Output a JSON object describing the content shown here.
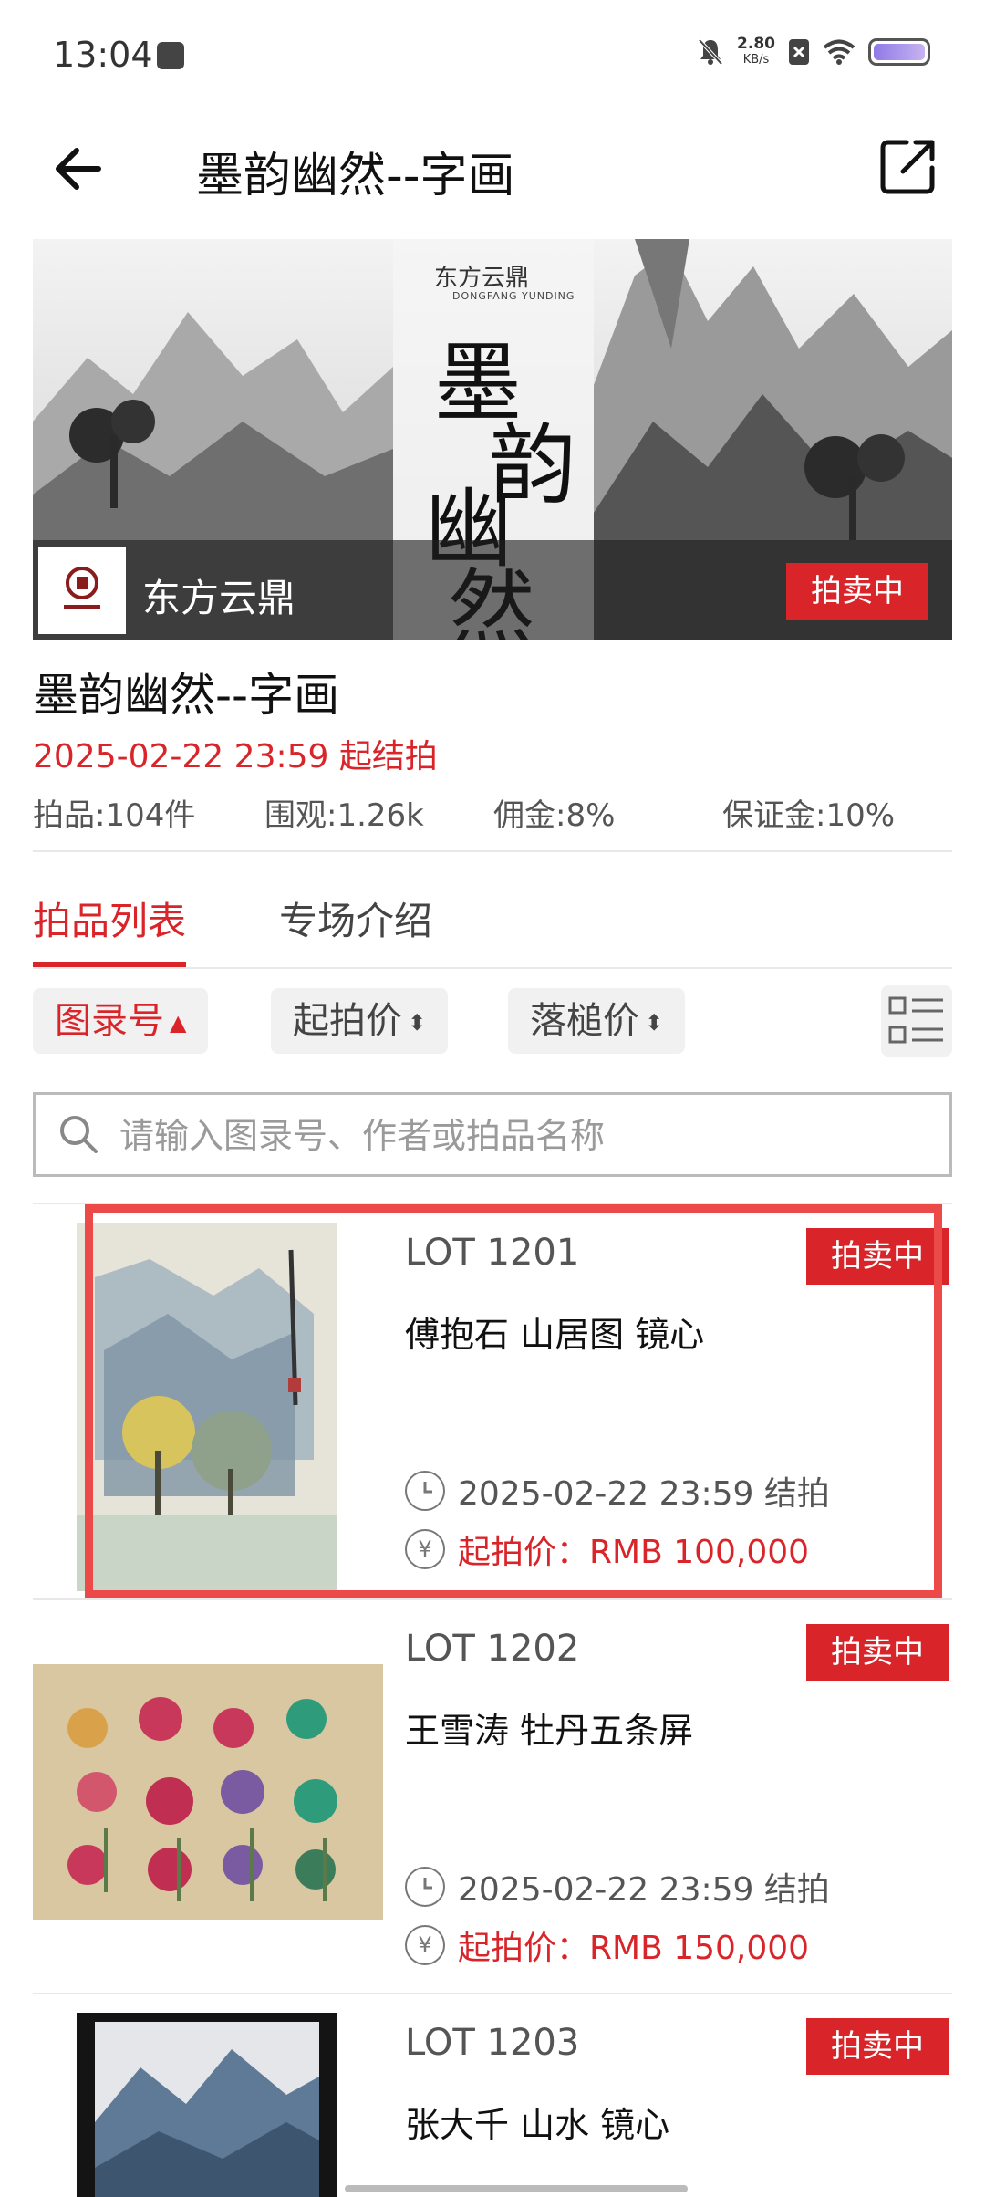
{
  "status_bar": {
    "time": "13:04",
    "speed_value": "2.80",
    "speed_unit": "KB/s"
  },
  "header": {
    "title": "墨韵幽然--字画"
  },
  "banner": {
    "brand_name": "东方云鼎",
    "brand_cn_small": "东方云鼎",
    "brand_en": "DONGFANG YUNDING",
    "calligraphy": [
      "墨",
      "韵",
      "幽",
      "然"
    ],
    "status_badge": "拍卖中"
  },
  "info": {
    "title": "墨韵幽然--字画",
    "date_text": "2025-02-22 23:59 起结拍",
    "stats": {
      "items": "拍品:104件",
      "views": "围观:1.26k",
      "commission": "佣金:8%",
      "deposit": "保证金:10%"
    }
  },
  "tabs": [
    {
      "label": "拍品列表",
      "active": true
    },
    {
      "label": "专场介绍",
      "active": false
    }
  ],
  "sort": [
    {
      "label": "图录号",
      "arrow": "▲",
      "active": true
    },
    {
      "label": "起拍价",
      "arrow": "⬍",
      "active": false
    },
    {
      "label": "落槌价",
      "arrow": "⬍",
      "active": false
    }
  ],
  "search": {
    "placeholder": "请输入图录号、作者或拍品名称"
  },
  "lots": [
    {
      "lot": "LOT 1201",
      "name": "傅抱石 山居图 镜心",
      "badge": "拍卖中",
      "end_time": "2025-02-22 23:59 结拍",
      "price": "起拍价：RMB 100,000"
    },
    {
      "lot": "LOT 1202",
      "name": "王雪涛 牡丹五条屏",
      "badge": "拍卖中",
      "end_time": "2025-02-22 23:59 结拍",
      "price": "起拍价：RMB 150,000"
    },
    {
      "lot": "LOT 1203",
      "name": "张大千 山水 镜心",
      "badge": "拍卖中"
    }
  ],
  "icons": {
    "clock": "clock-icon",
    "yuan": "yuan-icon",
    "currency_symbol": "¥"
  },
  "colors": {
    "accent": "#d9252a",
    "highlight": "#ec4a49"
  }
}
